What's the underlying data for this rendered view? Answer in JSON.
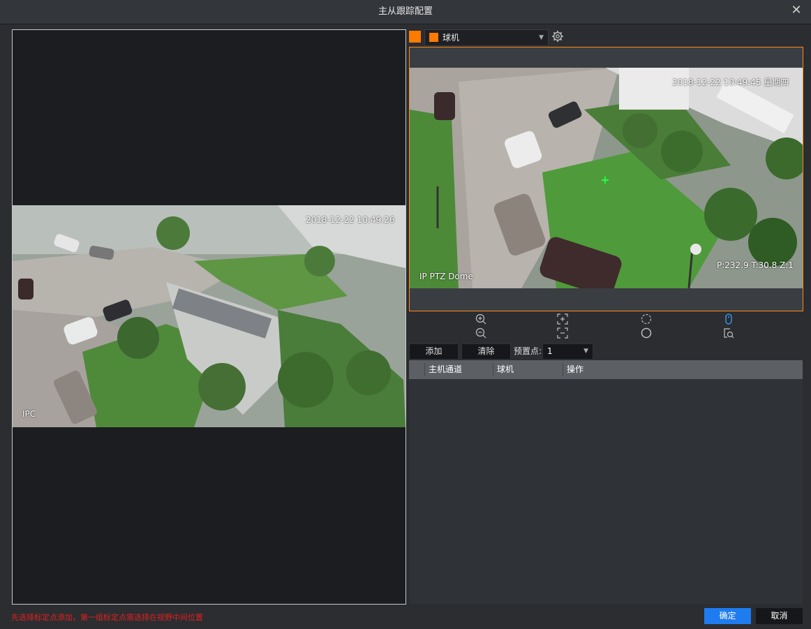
{
  "window": {
    "title": "主从跟踪配置",
    "close_glyph": "✕"
  },
  "left_video": {
    "timestamp": "2018-12-22 10:49:26",
    "channel_label": "IPC"
  },
  "camera_selector": {
    "selected": "球机"
  },
  "right_video": {
    "timestamp": "2018-12-22 10:49:45 星期四",
    "channel_label": "IP PTZ Dome",
    "ptz_readout": "P:232.9 T:30.8 Z:1"
  },
  "controls": {
    "add_label": "添加",
    "clear_label": "清除",
    "preset_label": "预置点:",
    "preset_value": "1"
  },
  "table": {
    "columns": [
      "主机通道",
      "球机",
      "操作"
    ]
  },
  "footer": {
    "hint": "先选择标定点添加，第一组标定点需选择在视野中间位置",
    "ok_label": "确定",
    "cancel_label": "取消"
  },
  "colors": {
    "accent": "#ff7a00",
    "primary_button": "#1e7cf0",
    "warning_text": "#e02020"
  }
}
